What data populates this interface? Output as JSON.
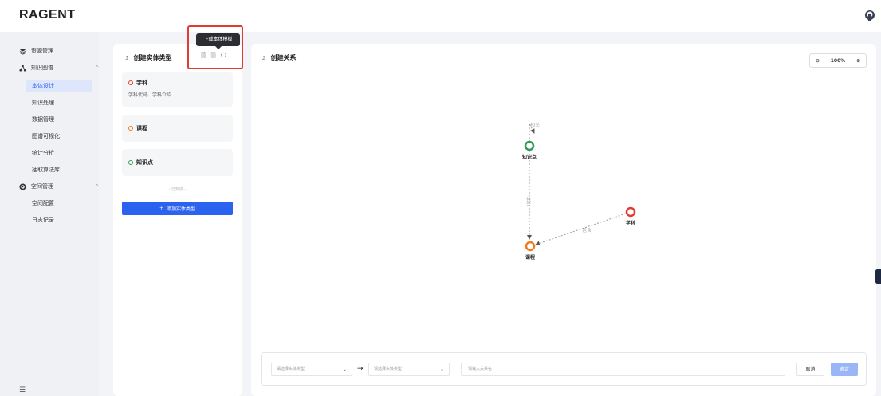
{
  "app": {
    "logo": "RAGENT"
  },
  "sidebar": {
    "groups": [
      {
        "label": "资源管理",
        "icon": "layers-icon"
      },
      {
        "label": "知识图谱",
        "icon": "graph-icon",
        "caret": "^"
      },
      {
        "label": "空间管理",
        "icon": "gear-icon",
        "caret": "^"
      }
    ],
    "kg_items": [
      "本体设计",
      "知识处理",
      "数据管理",
      "图谱可视化",
      "统计分析",
      "抽取算法库"
    ],
    "space_items": [
      "空间配置",
      "日志记录"
    ],
    "active": "本体设计",
    "toggle_icon": "☰"
  },
  "left_panel": {
    "step_num": "1",
    "title": "创建实体类型",
    "tooltip": "下载本体模板",
    "entities": [
      {
        "name": "学科",
        "desc": "学科代码、学科介绍",
        "color": "#e23b33"
      },
      {
        "name": "课程",
        "desc": "",
        "color": "#f07b1a"
      },
      {
        "name": "知识点",
        "desc": "",
        "color": "#2f9a56"
      }
    ],
    "end_hint": "- 已到底 -",
    "add_button": "添加实体类型",
    "add_icon": "+"
  },
  "right_panel": {
    "step_num": "2",
    "title": "创建关系",
    "zoom": "100%",
    "zoom_out_icon": "⊖",
    "zoom_in_icon": "⊕",
    "graph": {
      "nodes": [
        {
          "label": "知识点",
          "color": "#2f9a56"
        },
        {
          "label": "学科",
          "color": "#e23b33"
        },
        {
          "label": "课程",
          "color": "#f07b1a"
        }
      ],
      "edges": [
        {
          "label": "相关"
        },
        {
          "label": "包含"
        },
        {
          "label": "包含"
        }
      ]
    }
  },
  "bottom_bar": {
    "source_placeholder": "请选择实体类型",
    "target_placeholder": "请选择实体类型",
    "arrow": "→",
    "relation_placeholder": "请输入关系名",
    "cancel": "取消",
    "confirm": "确定"
  }
}
